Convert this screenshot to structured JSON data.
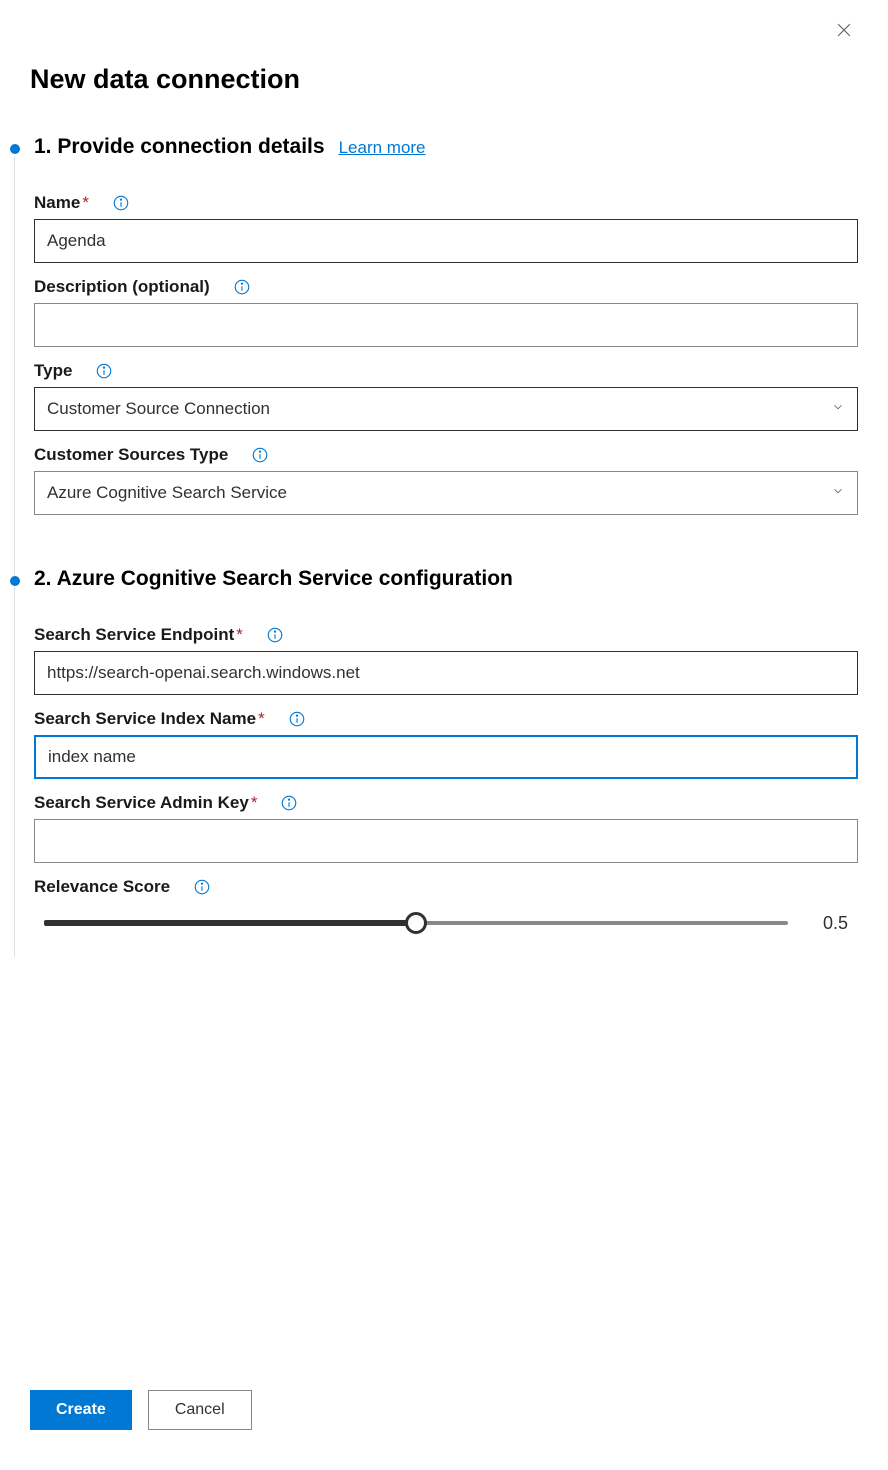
{
  "page_title": "New data connection",
  "close_label": "Close",
  "section1": {
    "title": "1. Provide connection details",
    "learn_more": "Learn more",
    "fields": {
      "name": {
        "label": "Name",
        "required": true,
        "value": "Agenda"
      },
      "description": {
        "label": "Description (optional)",
        "required": false,
        "value": ""
      },
      "type": {
        "label": "Type",
        "required": false,
        "value": "Customer Source Connection"
      },
      "cust_sources_type": {
        "label": "Customer Sources Type",
        "required": false,
        "value": "Azure Cognitive Search Service"
      }
    }
  },
  "section2": {
    "title": "2. Azure Cognitive Search Service configuration",
    "fields": {
      "endpoint": {
        "label": "Search Service Endpoint",
        "required": true,
        "value": "https://search-openai.search.windows.net"
      },
      "index_name": {
        "label": "Search Service Index Name",
        "required": true,
        "value": "index name"
      },
      "admin_key": {
        "label": "Search Service Admin Key",
        "required": true,
        "value": ""
      },
      "relevance": {
        "label": "Relevance Score",
        "value": "0.5"
      }
    }
  },
  "footer": {
    "create": "Create",
    "cancel": "Cancel"
  }
}
